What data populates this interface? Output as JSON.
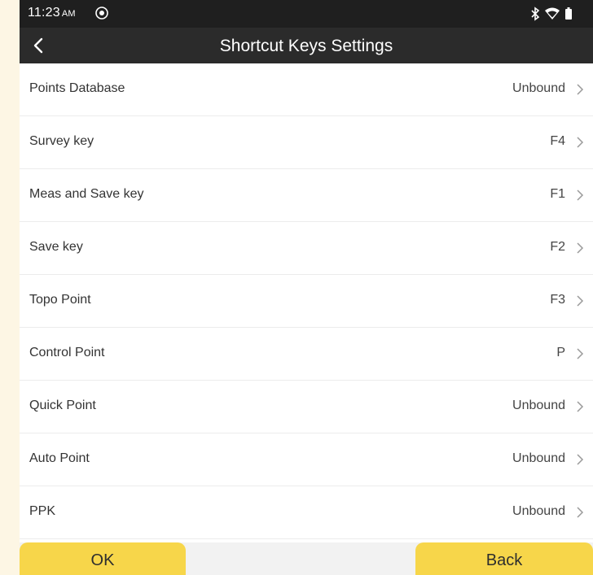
{
  "status_bar": {
    "time": "11:23",
    "ampm": "AM"
  },
  "header": {
    "title": "Shortcut Keys Settings"
  },
  "rows": [
    {
      "label": "Points Database",
      "value": "Unbound"
    },
    {
      "label": "Survey key",
      "value": "F4"
    },
    {
      "label": "Meas and Save key",
      "value": "F1"
    },
    {
      "label": "Save key",
      "value": "F2"
    },
    {
      "label": "Topo Point",
      "value": "F3"
    },
    {
      "label": "Control Point",
      "value": "P"
    },
    {
      "label": "Quick Point",
      "value": "Unbound"
    },
    {
      "label": "Auto Point",
      "value": "Unbound"
    },
    {
      "label": "PPK",
      "value": "Unbound"
    }
  ],
  "footer": {
    "ok_label": "OK",
    "back_label": "Back"
  },
  "colors": {
    "accent_yellow": "#f7d64a",
    "status_bar_bg": "#1f1f1f",
    "title_bar_bg": "#2b2b2b",
    "divider": "#ececec"
  },
  "icons": [
    "location-icon",
    "bluetooth-icon",
    "wifi-icon",
    "battery-icon",
    "back-arrow-icon",
    "chevron-right-icon"
  ]
}
